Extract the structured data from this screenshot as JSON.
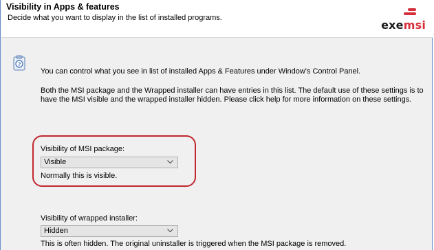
{
  "header": {
    "title": "Visibility in Apps & features",
    "subtitle": "Decide what you want to display in the list of installed programs."
  },
  "logo": {
    "text_exe": "exe",
    "text_msi": "msi",
    "colors": {
      "exe": "#1a1a1a",
      "msi": "#d62e3b",
      "bars": "#d62e3b"
    }
  },
  "info_icon": "info-clipboard-icon",
  "intro": "You can control what you see in list of installed Apps & Features under Window's Control Panel.",
  "description": "Both the MSI package and the Wrapped installer can have entries in this list. The default use of these settings is to have the MSI visible and the wrapped installer hidden. Please click help for more information on these settings.",
  "msi_visibility": {
    "label": "Visibility of MSI package:",
    "value": "Visible",
    "hint": "Normally this is visible."
  },
  "wrapped_visibility": {
    "label": "Visibility of wrapped installer:",
    "value": "Hidden",
    "hint": "This is often hidden. The original uninstaller is triggered when the MSI package is removed."
  },
  "highlight_color": "#c0282e"
}
